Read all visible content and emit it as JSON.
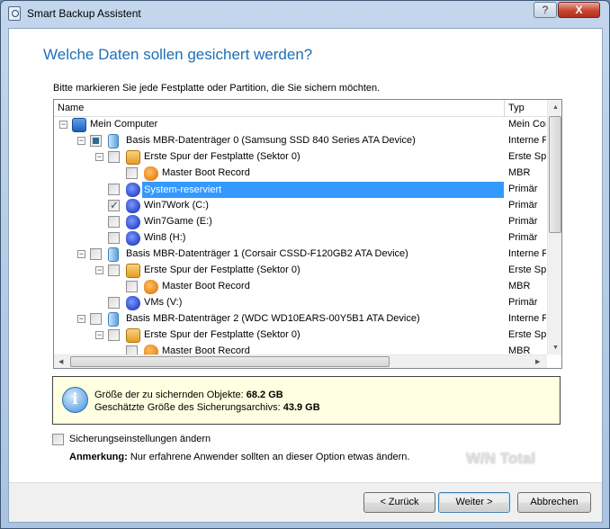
{
  "window": {
    "title": "Smart Backup Assistent",
    "help_label": "?",
    "close_label": "X"
  },
  "heading": "Welche Daten sollen gesichert werden?",
  "instruction": "Bitte markieren Sie jede Festplatte oder Partition, die Sie sichern möchten.",
  "list": {
    "columns": {
      "name": "Name",
      "type": "Typ"
    },
    "rows": [
      {
        "label": "Mein Computer",
        "type": "Mein Computer",
        "level": 0,
        "icon": "computer",
        "expander": "minus",
        "check": "none"
      },
      {
        "label": "Basis MBR-Datenträger 0 (Samsung SSD 840 Series ATA Device)",
        "type": "Interne Festplatte",
        "level": 1,
        "icon": "disk",
        "expander": "minus",
        "check": "partial"
      },
      {
        "label": "Erste Spur der Festplatte (Sektor 0)",
        "type": "Erste Spur",
        "level": 2,
        "icon": "track",
        "expander": "minus",
        "check": "unchecked"
      },
      {
        "label": "Master Boot Record",
        "type": "MBR",
        "level": 3,
        "icon": "mbr",
        "expander": "none",
        "check": "unchecked"
      },
      {
        "label": "System-reserviert",
        "type": "Primär",
        "level": 2,
        "icon": "part",
        "expander": "none",
        "check": "unchecked",
        "selected": true
      },
      {
        "label": "Win7Work (C:)",
        "type": "Primär",
        "level": 2,
        "icon": "part",
        "expander": "none",
        "check": "checked"
      },
      {
        "label": "Win7Game (E:)",
        "type": "Primär",
        "level": 2,
        "icon": "part",
        "expander": "none",
        "check": "unchecked"
      },
      {
        "label": "Win8 (H:)",
        "type": "Primär",
        "level": 2,
        "icon": "part",
        "expander": "none",
        "check": "unchecked"
      },
      {
        "label": "Basis MBR-Datenträger 1 (Corsair CSSD-F120GB2 ATA Device)",
        "type": "Interne Festplatte",
        "level": 1,
        "icon": "disk",
        "expander": "minus",
        "check": "unchecked"
      },
      {
        "label": "Erste Spur der Festplatte (Sektor 0)",
        "type": "Erste Spur",
        "level": 2,
        "icon": "track",
        "expander": "minus",
        "check": "unchecked"
      },
      {
        "label": "Master Boot Record",
        "type": "MBR",
        "level": 3,
        "icon": "mbr",
        "expander": "none",
        "check": "unchecked"
      },
      {
        "label": "VMs (V:)",
        "type": "Primär",
        "level": 2,
        "icon": "part",
        "expander": "none",
        "check": "unchecked"
      },
      {
        "label": "Basis MBR-Datenträger 2 (WDC WD10EARS-00Y5B1 ATA Device)",
        "type": "Interne Festplatte",
        "level": 1,
        "icon": "disk",
        "expander": "minus",
        "check": "unchecked"
      },
      {
        "label": "Erste Spur der Festplatte (Sektor 0)",
        "type": "Erste Spur",
        "level": 2,
        "icon": "track",
        "expander": "minus",
        "check": "unchecked"
      },
      {
        "label": "Master Boot Record",
        "type": "MBR",
        "level": 3,
        "icon": "mbr",
        "expander": "none",
        "check": "unchecked"
      }
    ]
  },
  "info": {
    "size_label": "Größe der zu sichernden Objekte:",
    "size_value": "68.2 GB",
    "archive_label": "Geschätzte Größe des Sicherungsarchivs:",
    "archive_value": "43.9 GB"
  },
  "options": {
    "change_settings_label": "Sicherungseinstellungen ändern",
    "note_label": "Anmerkung:",
    "note_text": "Nur erfahrene Anwender sollten an dieser Option etwas ändern."
  },
  "watermark": "WinTotal",
  "buttons": {
    "back": "< Zurück",
    "next": "Weiter >",
    "cancel": "Abbrechen"
  }
}
